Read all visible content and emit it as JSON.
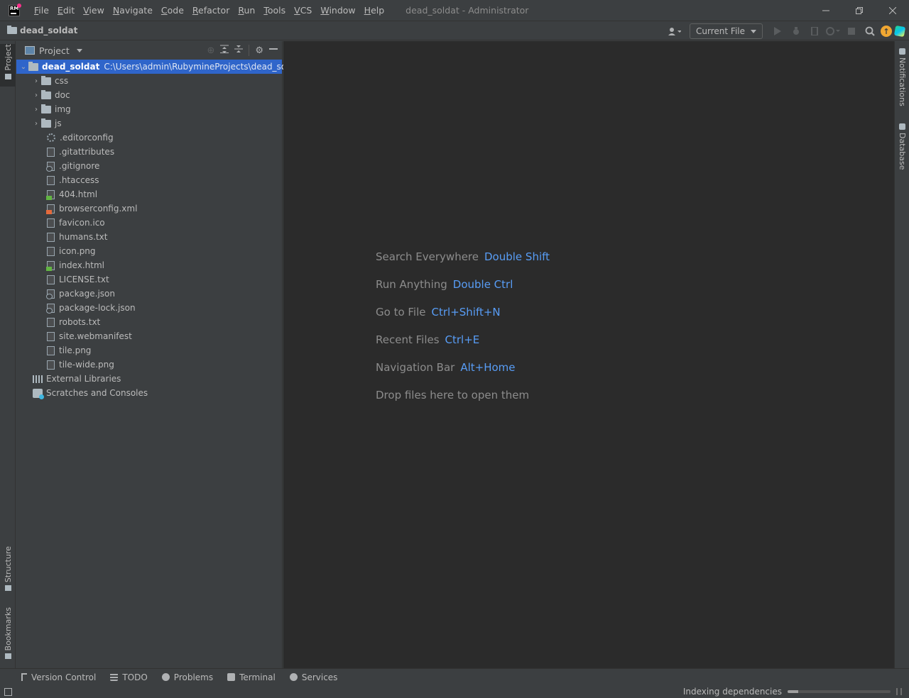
{
  "app": {
    "logo_text": "RM",
    "window_title": "dead_soldat - Administrator"
  },
  "menu": [
    "File",
    "Edit",
    "View",
    "Navigate",
    "Code",
    "Refactor",
    "Run",
    "Tools",
    "VCS",
    "Window",
    "Help"
  ],
  "navbar": {
    "project_name": "dead_soldat",
    "run_config": "Current File"
  },
  "left_stripe": {
    "project": "Project",
    "structure": "Structure",
    "bookmarks": "Bookmarks"
  },
  "right_stripe": {
    "notifications": "Notifications",
    "database": "Database"
  },
  "project_panel": {
    "title": "Project",
    "root": {
      "name": "dead_soldat",
      "path": "C:\\Users\\admin\\RubymineProjects\\dead_soldat"
    },
    "folders": [
      "css",
      "doc",
      "img",
      "js"
    ],
    "files": [
      {
        "name": ".editorconfig",
        "icon": "cog-file-icon"
      },
      {
        "name": ".gitattributes",
        "icon": "text-file-icon"
      },
      {
        "name": ".gitignore",
        "icon": "ignore-file-icon"
      },
      {
        "name": ".htaccess",
        "icon": "text-file-icon"
      },
      {
        "name": "404.html",
        "icon": "html-file-icon"
      },
      {
        "name": "browserconfig.xml",
        "icon": "xml-file-icon"
      },
      {
        "name": "favicon.ico",
        "icon": "image-file-icon"
      },
      {
        "name": "humans.txt",
        "icon": "text-file-icon"
      },
      {
        "name": "icon.png",
        "icon": "image-file-icon"
      },
      {
        "name": "index.html",
        "icon": "html-file-icon"
      },
      {
        "name": "LICENSE.txt",
        "icon": "text-file-icon"
      },
      {
        "name": "package.json",
        "icon": "json-file-icon"
      },
      {
        "name": "package-lock.json",
        "icon": "json-file-icon"
      },
      {
        "name": "robots.txt",
        "icon": "text-file-icon"
      },
      {
        "name": "site.webmanifest",
        "icon": "text-file-icon"
      },
      {
        "name": "tile.png",
        "icon": "image-file-icon"
      },
      {
        "name": "tile-wide.png",
        "icon": "image-file-icon"
      }
    ],
    "external_libraries": "External Libraries",
    "scratches": "Scratches and Consoles"
  },
  "editor_hints": [
    {
      "action": "Search Everywhere",
      "key": "Double Shift"
    },
    {
      "action": "Run Anything",
      "key": "Double Ctrl"
    },
    {
      "action": "Go to File",
      "key": "Ctrl+Shift+N"
    },
    {
      "action": "Recent Files",
      "key": "Ctrl+E"
    },
    {
      "action": "Navigation Bar",
      "key": "Alt+Home"
    },
    {
      "action": "Drop files here to open them",
      "key": ""
    }
  ],
  "bottom_tabs": [
    "Version Control",
    "TODO",
    "Problems",
    "Terminal",
    "Services"
  ],
  "status": {
    "text": "Indexing dependencies",
    "progress": 0.1
  },
  "colors": {
    "accent": "#2f65ca",
    "link": "#589df6",
    "editor_bg": "#2b2b2b",
    "panel_bg": "#3c3f41"
  }
}
